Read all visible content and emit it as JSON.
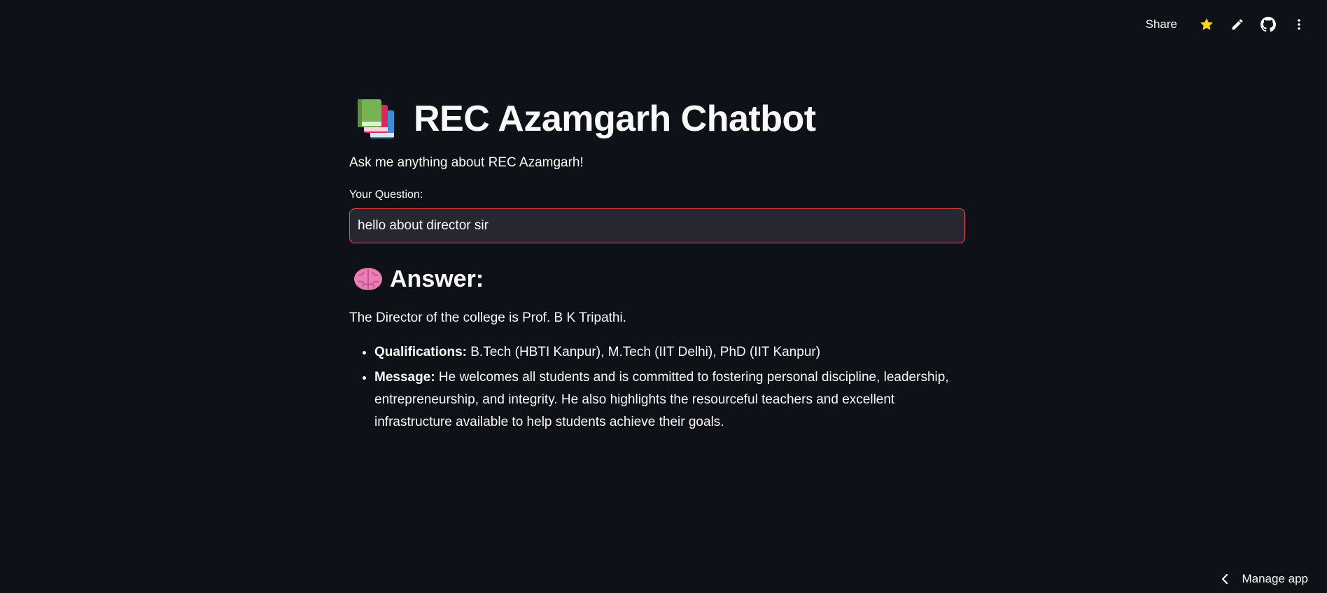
{
  "toolbar": {
    "share_label": "Share",
    "icons": [
      "star-icon",
      "pencil-icon",
      "github-icon",
      "kebab-menu-icon"
    ],
    "star_color": "#ffd21f"
  },
  "main": {
    "title_emoji": "books",
    "title": "REC Azamgarh Chatbot",
    "subtitle": "Ask me anything about REC Azamgarh!",
    "question_label": "Your Question:",
    "question_value": "hello about director sir",
    "answer_emoji": "brain",
    "answer_heading": "Answer:",
    "answer_intro": "The Director of the college is Prof. B K Tripathi.",
    "answer_items": [
      {
        "label": "Qualifications:",
        "text": " B.Tech (HBTI Kanpur), M.Tech (IIT Delhi), PhD (IIT Kanpur)"
      },
      {
        "label": "Message:",
        "text": " He welcomes all students and is committed to fostering personal discipline, leadership, entrepreneurship, and integrity. He also highlights the resourceful teachers and excellent infrastructure available to help students achieve their goals."
      }
    ]
  },
  "footer": {
    "manage_label": "Manage app"
  },
  "colors": {
    "background": "#0e1117",
    "input_background": "#262730",
    "input_focus_border": "#ff4b4b",
    "text": "#fafafa"
  }
}
